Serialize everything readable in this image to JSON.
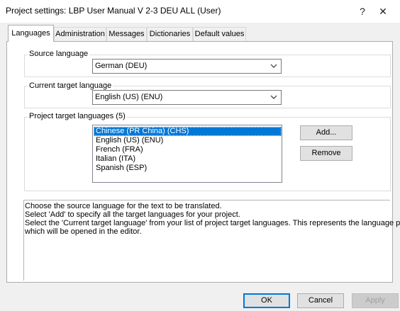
{
  "window": {
    "title": "Project settings: LBP User Manual V 2-3 DEU ALL (User)",
    "help_glyph": "?",
    "close_glyph": "✕"
  },
  "tabs": [
    {
      "label": "Languages",
      "active": true
    },
    {
      "label": "Administration",
      "active": false
    },
    {
      "label": "Messages",
      "active": false
    },
    {
      "label": "Dictionaries",
      "active": false
    },
    {
      "label": "Default values",
      "active": false
    }
  ],
  "source_language": {
    "legend": "Source language",
    "value": "German (DEU)"
  },
  "current_target_language": {
    "legend": "Current target language",
    "value": "English (US) (ENU)"
  },
  "project_target_languages": {
    "legend": "Project target languages (5)",
    "items": [
      "Chinese (PR China) (CHS)",
      "English (US) (ENU)",
      "French (FRA)",
      "Italian (ITA)",
      "Spanish (ESP)"
    ],
    "selected_index": 0,
    "add_label": "Add...",
    "remove_label": "Remove"
  },
  "help_text": [
    "Choose the source language for the text to be translated.",
    "Select 'Add' to specify all the target languages for your project.",
    "Select the 'Current target language' from your list of project target languages. This represents the language pair",
    "which will be opened in the editor."
  ],
  "footer": {
    "ok_label": "OK",
    "cancel_label": "Cancel",
    "apply_label": "Apply"
  },
  "colors": {
    "selection": "#0078d7",
    "dialog_bg": "#f0f0f0"
  }
}
